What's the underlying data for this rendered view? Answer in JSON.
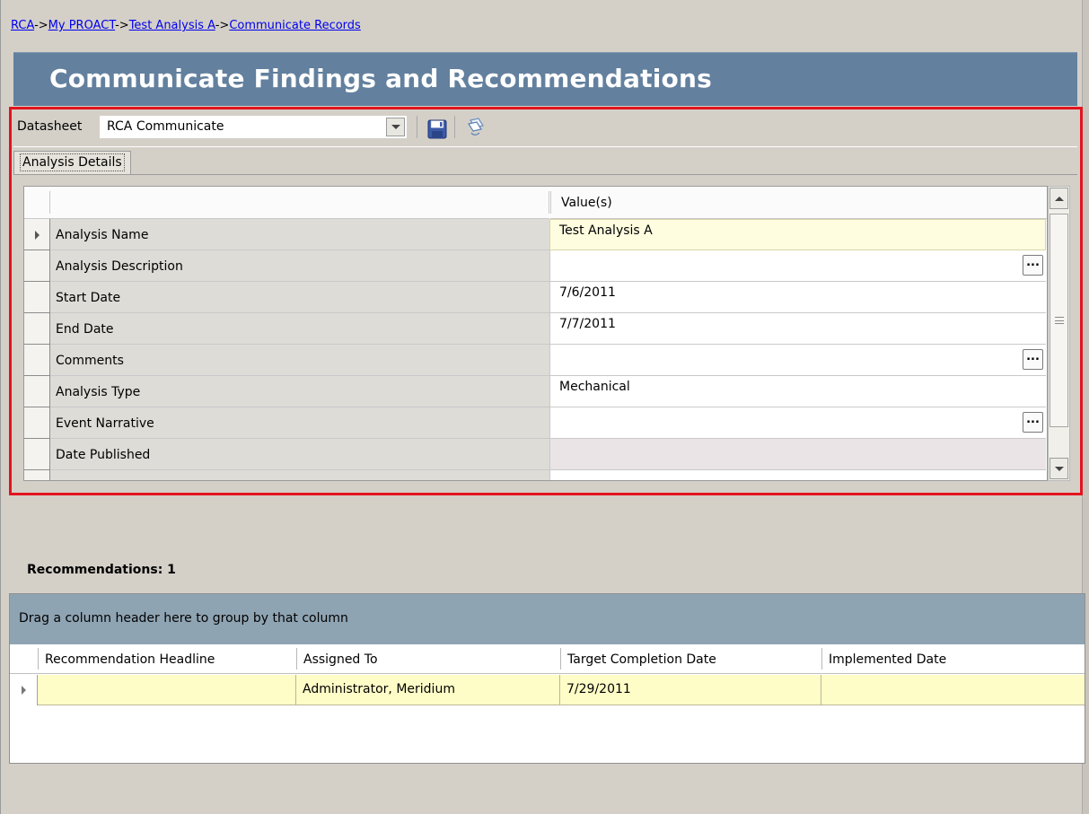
{
  "breadcrumb": [
    {
      "label": "RCA"
    },
    {
      "label": "My PROACT"
    },
    {
      "label": "Test Analysis A"
    },
    {
      "label": "Communicate Records"
    }
  ],
  "breadcrumb_separator": "->",
  "page_title": "Communicate Findings and Recommendations",
  "toolbar": {
    "datasheet_label": "Datasheet",
    "datasheet_value": "RCA Communicate",
    "save_icon": "save-icon",
    "copy_icon": "copy-icon"
  },
  "tabs": [
    {
      "label": "Analysis Details"
    }
  ],
  "grid": {
    "value_header": "Value(s)",
    "rows": [
      {
        "name": "Analysis Name",
        "value": "Test Analysis A"
      },
      {
        "name": "Analysis Description",
        "value": ""
      },
      {
        "name": "Start Date",
        "value": "7/6/2011"
      },
      {
        "name": "End Date",
        "value": "7/7/2011"
      },
      {
        "name": "Comments",
        "value": ""
      },
      {
        "name": "Analysis Type",
        "value": "Mechanical"
      },
      {
        "name": "Event Narrative",
        "value": ""
      },
      {
        "name": "Date Published",
        "value": ""
      }
    ],
    "ellipsis_label": "..."
  },
  "recommendations": {
    "label": "Recommendations:  1",
    "group_bar_text": "Drag a column header here to group by that column",
    "columns": [
      "Recommendation Headline",
      "Assigned To",
      "Target Completion Date",
      "Implemented Date"
    ],
    "rows": [
      {
        "headline": "",
        "assigned_to": "Administrator, Meridium",
        "target_completion_date": "7/29/2011",
        "implemented_date": ""
      }
    ]
  },
  "colors": {
    "banner": "#63809e",
    "highlight_border": "#e2141e",
    "group_bar": "#8fa4b3",
    "selected_row": "#fffdc7",
    "link": "#0000ee"
  }
}
